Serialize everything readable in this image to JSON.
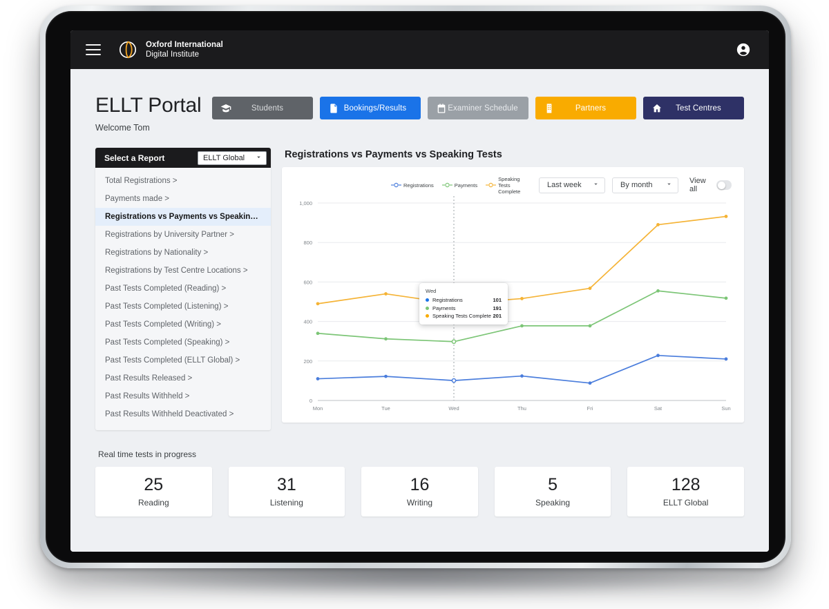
{
  "header": {
    "menu_icon": "hamburger-menu-icon",
    "brand_line1": "Oxford International",
    "brand_line2": "Digital Institute",
    "brand_logo_icon": "oxford-logo-icon",
    "account_icon": "account-circle-icon",
    "bg_color": "#1b1b1d"
  },
  "page": {
    "title": "ELLT Portal",
    "welcome": "Welcome Tom"
  },
  "nav_pills": [
    {
      "label": "Students",
      "icon": "graduation-cap-icon",
      "bg": "#5f6368",
      "fg": "#d9dbdd"
    },
    {
      "label": "Bookings/Results",
      "icon": "document-icon",
      "bg": "#1a73e8",
      "fg": "#ffffff"
    },
    {
      "label": "Examiner Schedule",
      "icon": "calendar-icon",
      "bg": "#9aa0a6",
      "fg": "#e8eaed"
    },
    {
      "label": "Partners",
      "icon": "building-icon",
      "bg": "#f9ab00",
      "fg": "#ffffff"
    },
    {
      "label": "Test Centres",
      "icon": "home-icon",
      "bg": "#2e3166",
      "fg": "#ffffff"
    }
  ],
  "report_panel": {
    "heading": "Select a Report",
    "select_value": "ELLT Global",
    "select_icon": "chevron-down-icon",
    "items": [
      {
        "label": "Total Registrations >",
        "active": false
      },
      {
        "label": "Payments made >",
        "active": false
      },
      {
        "label": "Registrations vs Payments vs Speaking Tests >",
        "active": true
      },
      {
        "label": "Registrations by University Partner >",
        "active": false
      },
      {
        "label": "Registrations by Nationality >",
        "active": false
      },
      {
        "label": "Registrations by Test Centre Locations >",
        "active": false
      },
      {
        "label": "Past Tests Completed (Reading) >",
        "active": false
      },
      {
        "label": "Past Tests Completed (Listening) >",
        "active": false
      },
      {
        "label": "Past Tests Completed (Writing) >",
        "active": false
      },
      {
        "label": "Past Tests Completed (Speaking) >",
        "active": false
      },
      {
        "label": "Past Tests Completed (ELLT Global) >",
        "active": false
      },
      {
        "label": "Past Results Released >",
        "active": false
      },
      {
        "label": "Past Results Withheld >",
        "active": false
      },
      {
        "label": "Past Results Withheld Deactivated >",
        "active": false
      }
    ]
  },
  "chart_panel": {
    "title": "Registrations vs Payments vs Speaking Tests",
    "range_select": "Last week",
    "group_select": "By month",
    "view_all_label": "View all",
    "view_all_on": false,
    "chevron_icon": "chevron-down-icon"
  },
  "tooltip": {
    "title": "Wed",
    "rows": [
      {
        "name": "Registrations",
        "value": "101",
        "color": "#1a73e8"
      },
      {
        "name": "Payments",
        "value": "191",
        "color": "#7cc576"
      },
      {
        "name": "Speaking Tests Complete",
        "value": "201",
        "color": "#f9ab00"
      }
    ]
  },
  "stats": {
    "label": "Real time tests in progress",
    "cards": [
      {
        "value": "25",
        "name": "Reading"
      },
      {
        "value": "31",
        "name": "Listening"
      },
      {
        "value": "16",
        "name": "Writing"
      },
      {
        "value": "5",
        "name": "Speaking"
      },
      {
        "value": "128",
        "name": "ELLT Global"
      }
    ]
  },
  "chart_data": {
    "type": "line",
    "title": "Registrations vs Payments vs Speaking Tests",
    "xlabel": "",
    "ylabel": "",
    "categories": [
      "Mon",
      "Tue",
      "Wed",
      "Thu",
      "Fri",
      "Sat",
      "Sun"
    ],
    "ylim": [
      0,
      1000
    ],
    "yticks": [
      0,
      200,
      400,
      600,
      800,
      1000
    ],
    "ytick_labels": [
      "0",
      "200",
      "400",
      "600",
      "800",
      "1,000"
    ],
    "grid": true,
    "legend_position": "top-center",
    "hover_category": "Wed",
    "series": [
      {
        "name": "Registrations",
        "color": "#4a7ddc",
        "values": [
          110,
          122,
          101,
          124,
          88,
          228,
          210
        ]
      },
      {
        "name": "Payments",
        "color": "#7cc576",
        "values": [
          340,
          312,
          298,
          378,
          378,
          555,
          518
        ]
      },
      {
        "name": "Speaking Tests Complete",
        "color": "#f5b335",
        "values": [
          490,
          540,
          490,
          516,
          568,
          890,
          932
        ]
      }
    ]
  }
}
